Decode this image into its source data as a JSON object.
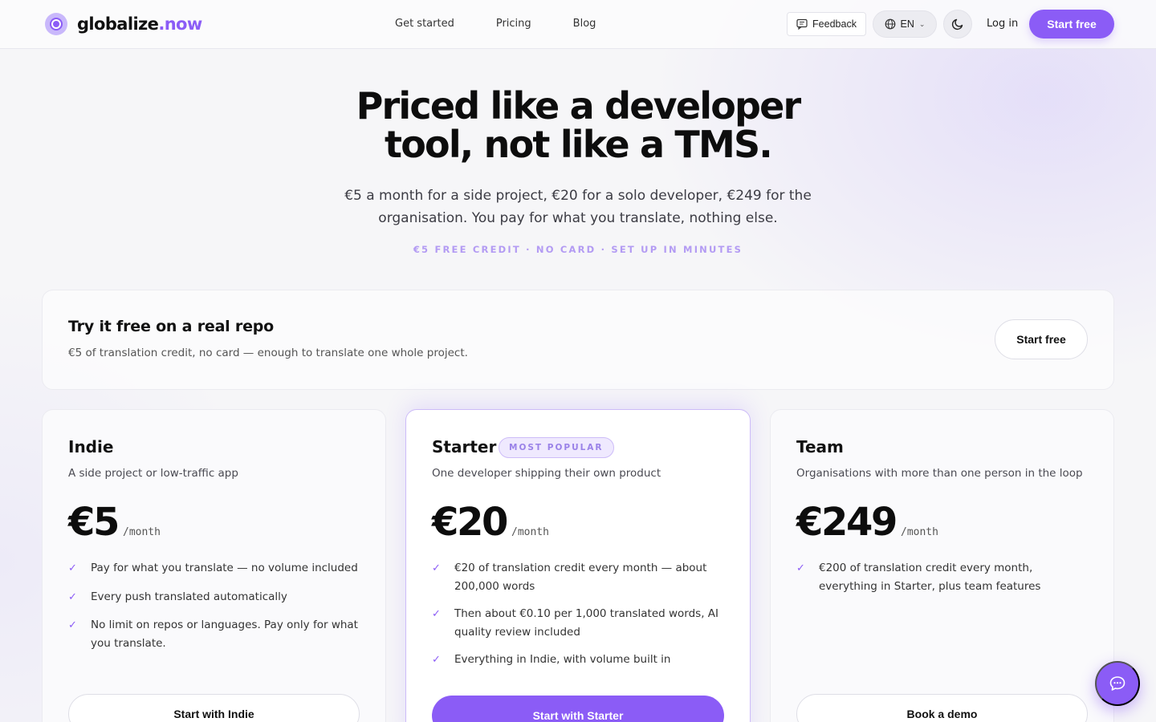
{
  "header": {
    "logo": {
      "name": "globalize",
      "suffix": ".now"
    },
    "nav": [
      "Get started",
      "Pricing",
      "Blog"
    ],
    "feedback_label": "Feedback",
    "language_label": "EN",
    "login_label": "Log in",
    "start_free_label": "Start free"
  },
  "hero": {
    "title_line1": "Priced like a developer",
    "title_line2": "tool, not like a TMS.",
    "subtitle": "€5 a month for a side project, €20 for a solo developer, €249 for the organisation. You pay for what you translate, nothing else.",
    "tagline": "€5 FREE CREDIT · NO CARD · SET UP IN MINUTES"
  },
  "trial": {
    "title": "Try it free on a real repo",
    "description": "€5 of translation credit, no card — enough to translate one whole project.",
    "button_label": "Start free"
  },
  "plans": [
    {
      "name": "Indie",
      "description": "A side project or low-traffic app",
      "price": "€5",
      "unit": "/month",
      "features": [
        "Pay for what you translate — no volume included",
        "Every push translated automatically",
        "No limit on repos or languages. Pay only for what you translate."
      ],
      "button_label": "Start with Indie"
    },
    {
      "name": "Starter",
      "badge": "MOST POPULAR",
      "description": "One developer shipping their own product",
      "price": "€20",
      "unit": "/month",
      "features": [
        "€20 of translation credit every month — about 200,000 words",
        "Then about €0.10 per 1,000 translated words, AI quality review included",
        "Everything in Indie, with volume built in"
      ],
      "button_label": "Start with Starter"
    },
    {
      "name": "Team",
      "description": "Organisations with more than one person in the loop",
      "price": "€249",
      "unit": "/month",
      "features": [
        "€200 of translation credit every month, everything in Starter, plus team features"
      ],
      "button_label": "Book a demo"
    }
  ],
  "colors": {
    "accent": "#8b5cf6",
    "accent_light": "#efe9fe",
    "background": "#f6f6f8",
    "text": "#111111"
  },
  "icons": [
    "logo-icon",
    "feedback-icon",
    "globe-icon",
    "chevron-down-icon",
    "moon-icon",
    "check-icon",
    "chat-icon"
  ]
}
